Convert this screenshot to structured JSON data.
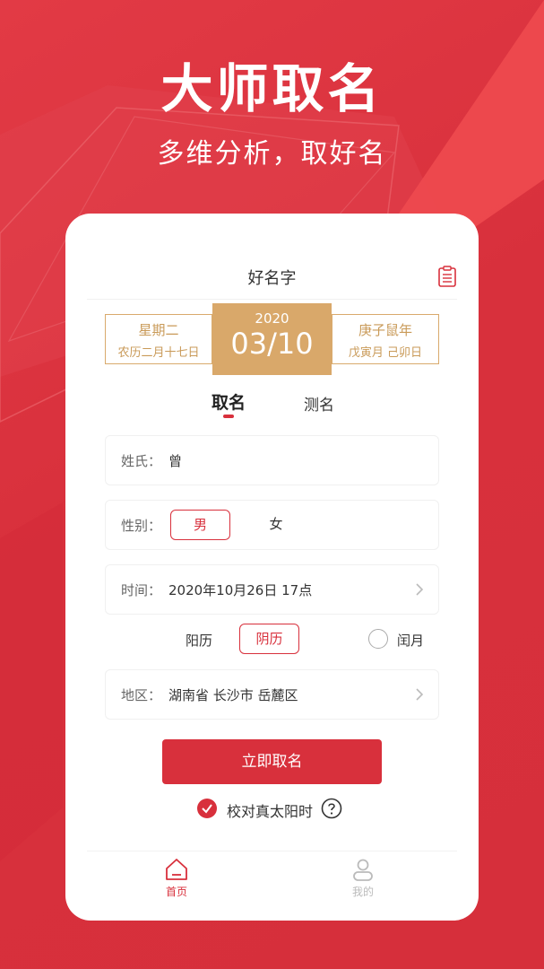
{
  "hero": {
    "title": "大师取名",
    "subtitle": "多维分析，取好名"
  },
  "card": {
    "title": "好名字",
    "header_icon": "clipboard-icon"
  },
  "date": {
    "left_line1": "星期二",
    "left_line2": "农历二月十七日",
    "year": "2020",
    "day": "03/10",
    "right_line1": "庚子鼠年",
    "right_line2": "戊寅月 己卯日"
  },
  "tabs": [
    {
      "label": "取名",
      "active": true
    },
    {
      "label": "测名",
      "active": false
    }
  ],
  "form": {
    "surname_label": "姓氏：",
    "surname_value": "曾",
    "gender_label": "性别：",
    "gender_male": "男",
    "gender_female": "女",
    "time_label": "时间：",
    "time_value": "2020年10月26日 17点",
    "calendar_solar": "阳历",
    "calendar_lunar": "阴历",
    "leap_month": "闰月",
    "region_label": "地区：",
    "region_value": "湖南省 长沙市 岳麓区"
  },
  "actions": {
    "submit_label": "立即取名",
    "verify_label": "校对真太阳时"
  },
  "nav": {
    "home_label": "首页",
    "mine_label": "我的"
  },
  "colors": {
    "primary": "#d8303c",
    "gold": "#d9a86a",
    "gold_text": "#c99a58"
  }
}
